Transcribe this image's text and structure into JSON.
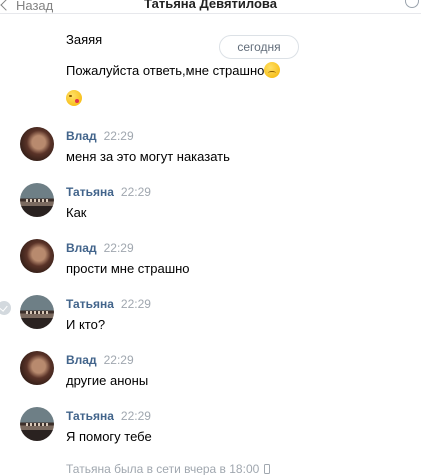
{
  "header": {
    "back_label": "Назад",
    "title": "Татьяна Девятилова",
    "refresh_icon": "refresh-icon"
  },
  "date_separator": "сегодня",
  "prev_messages": [
    {
      "text": "Заяяя"
    },
    {
      "text": "Пожалуйста ответь,мне страшно",
      "emoji": "worried-face-icon"
    },
    {
      "emoji": "kissing-face-icon"
    }
  ],
  "messages": [
    {
      "author": "Влад",
      "time": "22:29",
      "text": "меня за это могут наказать",
      "avatar": "vlad"
    },
    {
      "author": "Татьяна",
      "time": "22:29",
      "text": "Как",
      "avatar": "tatiana"
    },
    {
      "author": "Влад",
      "time": "22:29",
      "text": "прости мне страшно",
      "avatar": "vlad"
    },
    {
      "author": "Татьяна",
      "time": "22:29",
      "text": "И кто?",
      "avatar": "tatiana",
      "selected_check": true
    },
    {
      "author": "Влад",
      "time": "22:29",
      "text": "другие аноны",
      "avatar": "vlad"
    },
    {
      "author": "Татьяна",
      "time": "22:29",
      "text": "Я помогу тебе",
      "avatar": "tatiana"
    }
  ],
  "status": {
    "text": "Татьяна была в сети вчера в 18:00",
    "icon": "mobile-phone-icon"
  },
  "colors": {
    "author_name": "#42648b",
    "timestamp": "#a0a7af",
    "divider": "#e7e8ec"
  }
}
